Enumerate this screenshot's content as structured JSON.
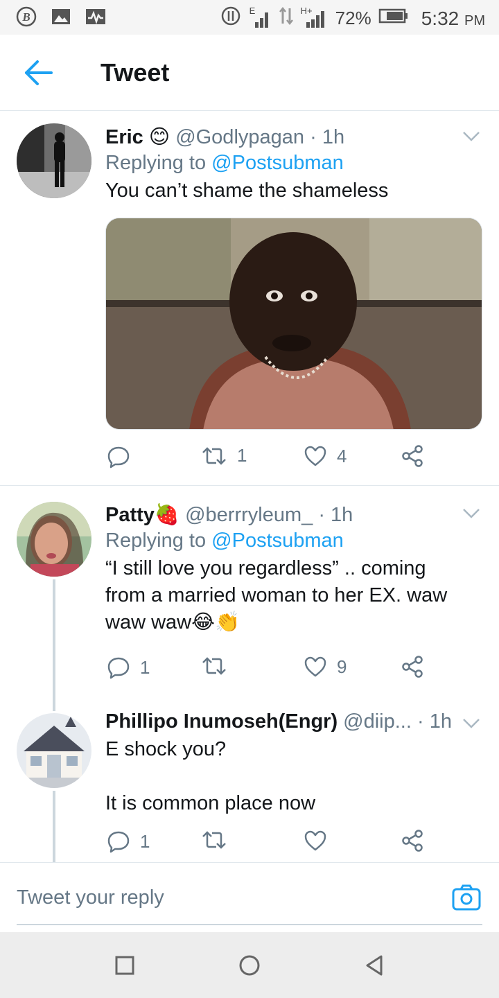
{
  "status_bar": {
    "left_icons": [
      "b-circle-icon",
      "image-icon",
      "pulse-icon"
    ],
    "network_label": "E",
    "network_label_2": "H+",
    "battery": "72%",
    "time": "5:32",
    "ampm": "PM"
  },
  "header": {
    "title": "Tweet"
  },
  "tweets": [
    {
      "name": "Eric",
      "emoji": "😊",
      "handle": "@Godlypagan",
      "separator": "·",
      "time": "1h",
      "replying_prefix": "Replying to",
      "replying_to": "@Postsubman",
      "text": "You can’t shame the shameless",
      "actions": {
        "replies": "",
        "retweets": "1",
        "likes": "4"
      }
    },
    {
      "name": "Patty",
      "emoji": "🍓",
      "handle": "@berrryleum_",
      "separator": "·",
      "time": "1h",
      "replying_prefix": "Replying to",
      "replying_to": "@Postsubman",
      "text_line1": "“I still love you regardless” .. coming",
      "text_line2": "from a married woman to her EX. waw",
      "text_line3": "waw waw😂👏",
      "actions": {
        "replies": "1",
        "retweets": "",
        "likes": "9"
      }
    },
    {
      "name": "Phillipo Inumoseh(Engr)",
      "handle": "@diip...",
      "separator": "·",
      "time": "1h",
      "text_line1": "E shock you?",
      "text_line2": "It is common place now",
      "actions": {
        "replies": "1",
        "retweets": "",
        "likes": ""
      }
    }
  ],
  "reply_bar": {
    "placeholder": "Tweet your reply"
  },
  "colors": {
    "accent": "#1da1f2",
    "secondary_text": "#657786",
    "divider": "#e1e8ed"
  }
}
